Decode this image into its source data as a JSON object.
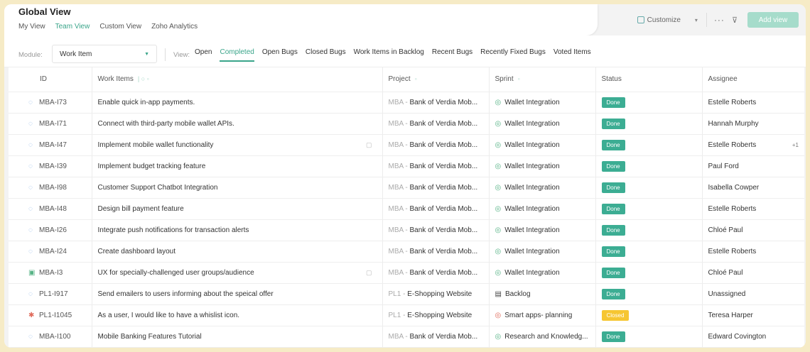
{
  "header": {
    "title": "Global View",
    "tabs": [
      {
        "label": "My View",
        "active": false
      },
      {
        "label": "Team View",
        "active": true
      },
      {
        "label": "Custom View",
        "active": false
      },
      {
        "label": "Zoho Analytics",
        "active": false
      }
    ],
    "customize_label": "Customize",
    "more_label": "···",
    "filter_label": "⊽",
    "add_view_label": "Add view"
  },
  "filterbar": {
    "module_label": "Module:",
    "module_value": "Work Item",
    "view_label": "View:",
    "filters": [
      {
        "label": "Open",
        "active": false
      },
      {
        "label": "Completed",
        "active": true
      },
      {
        "label": "Open Bugs",
        "active": false
      },
      {
        "label": "Closed Bugs",
        "active": false
      },
      {
        "label": "Work Items in Backlog",
        "active": false
      },
      {
        "label": "Recent Bugs",
        "active": false
      },
      {
        "label": "Recently Fixed Bugs",
        "active": false
      },
      {
        "label": "Voted Items",
        "active": false
      }
    ]
  },
  "table": {
    "columns": {
      "id": "ID",
      "work_items": "Work Items",
      "project": "Project",
      "sprint": "Sprint",
      "status": "Status",
      "assignee": "Assignee"
    },
    "status_colors": {
      "Done": "#3cad93",
      "Closed": "#f6c632"
    },
    "rows": [
      {
        "type": "task",
        "id": "MBA-I73",
        "title": "Enable quick in-app payments.",
        "proj_code": "MBA",
        "proj_name": "Bank of Verdia Mob...",
        "sprint_icon": "sprint",
        "sprint": "Wallet Integration",
        "status": "Done",
        "assignee": "Estelle Roberts",
        "extra": "",
        "note": false
      },
      {
        "type": "task",
        "id": "MBA-I71",
        "title": "Connect with third-party mobile wallet APIs.",
        "proj_code": "MBA",
        "proj_name": "Bank of Verdia Mob...",
        "sprint_icon": "sprint",
        "sprint": "Wallet Integration",
        "status": "Done",
        "assignee": "Hannah Murphy",
        "extra": "",
        "note": false
      },
      {
        "type": "task",
        "id": "MBA-I47",
        "title": "Implement mobile wallet functionality",
        "proj_code": "MBA",
        "proj_name": "Bank of Verdia Mob...",
        "sprint_icon": "sprint",
        "sprint": "Wallet Integration",
        "status": "Done",
        "assignee": "Estelle Roberts",
        "extra": "+1",
        "note": true
      },
      {
        "type": "task",
        "id": "MBA-I39",
        "title": "Implement budget tracking feature",
        "proj_code": "MBA",
        "proj_name": "Bank of Verdia Mob...",
        "sprint_icon": "sprint",
        "sprint": "Wallet Integration",
        "status": "Done",
        "assignee": "Paul Ford",
        "extra": "",
        "note": false
      },
      {
        "type": "task",
        "id": "MBA-I98",
        "title": "Customer Support Chatbot Integration",
        "proj_code": "MBA",
        "proj_name": "Bank of Verdia Mob...",
        "sprint_icon": "sprint",
        "sprint": "Wallet Integration",
        "status": "Done",
        "assignee": "Isabella Cowper",
        "extra": "",
        "note": false
      },
      {
        "type": "task",
        "id": "MBA-I48",
        "title": "Design bill payment feature",
        "proj_code": "MBA",
        "proj_name": "Bank of Verdia Mob...",
        "sprint_icon": "sprint",
        "sprint": "Wallet Integration",
        "status": "Done",
        "assignee": "Estelle Roberts",
        "extra": "",
        "note": false
      },
      {
        "type": "task",
        "id": "MBA-I26",
        "title": "Integrate push notifications for transaction alerts",
        "proj_code": "MBA",
        "proj_name": "Bank of Verdia Mob...",
        "sprint_icon": "sprint",
        "sprint": "Wallet Integration",
        "status": "Done",
        "assignee": "Chloé Paul",
        "extra": "",
        "note": false
      },
      {
        "type": "task",
        "id": "MBA-I24",
        "title": "Create dashboard layout",
        "proj_code": "MBA",
        "proj_name": "Bank of Verdia Mob...",
        "sprint_icon": "sprint",
        "sprint": "Wallet Integration",
        "status": "Done",
        "assignee": "Estelle Roberts",
        "extra": "",
        "note": false
      },
      {
        "type": "story",
        "id": "MBA-I3",
        "title": "UX for specially-challenged user groups/audience",
        "proj_code": "MBA",
        "proj_name": "Bank of Verdia Mob...",
        "sprint_icon": "sprint",
        "sprint": "Wallet Integration",
        "status": "Done",
        "assignee": "Chloé Paul",
        "extra": "",
        "note": true
      },
      {
        "type": "task",
        "id": "PL1-I917",
        "title": "Send emailers to users informing about the speical offer",
        "proj_code": "PL1",
        "proj_name": "E-Shopping Website",
        "sprint_icon": "backlog",
        "sprint": "Backlog",
        "status": "Done",
        "assignee": "Unassigned",
        "extra": "",
        "note": false
      },
      {
        "type": "bug",
        "id": "PL1-I1045",
        "title": "As a user, I would like to have a whislist icon.",
        "proj_code": "PL1",
        "proj_name": "E-Shopping Website",
        "sprint_icon": "red",
        "sprint": "Smart apps- planning",
        "status": "Closed",
        "assignee": "Teresa Harper",
        "extra": "",
        "note": false
      },
      {
        "type": "task",
        "id": "MBA-I100",
        "title": "Mobile Banking Features Tutorial",
        "proj_code": "MBA",
        "proj_name": "Bank of Verdia Mob...",
        "sprint_icon": "sprint",
        "sprint": "Research and Knowledg...",
        "status": "Done",
        "assignee": "Edward Covington",
        "extra": "",
        "note": false
      }
    ]
  }
}
